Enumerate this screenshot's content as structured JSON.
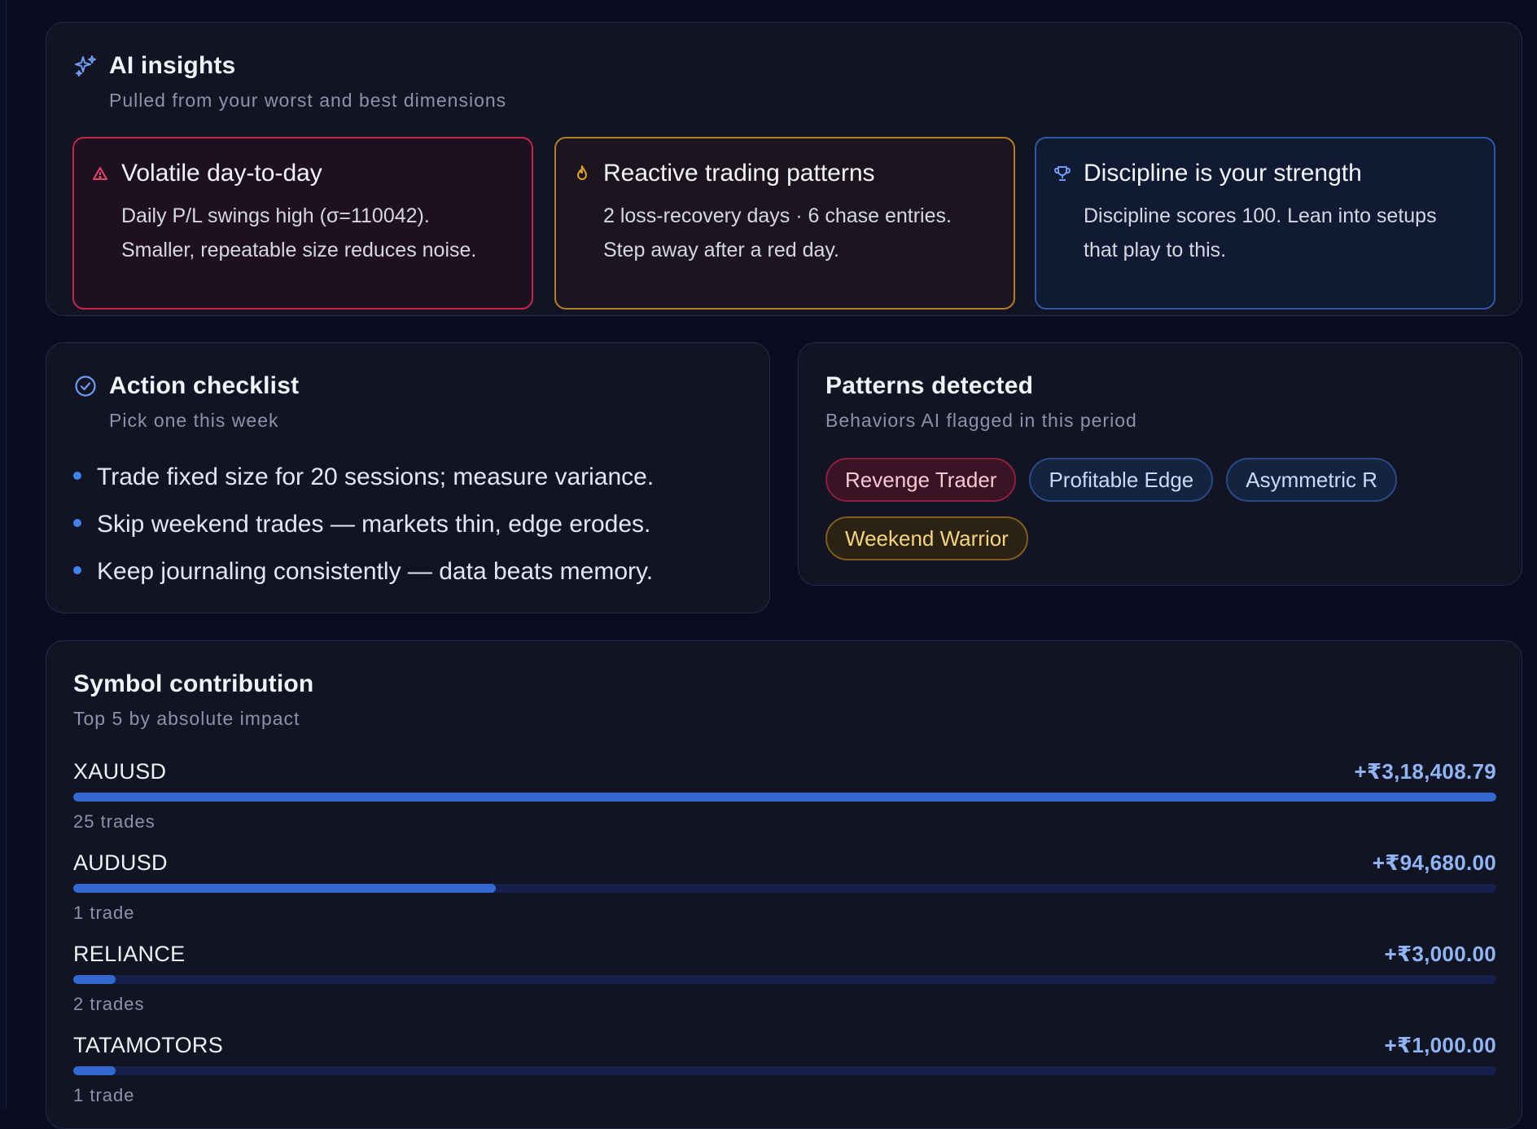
{
  "ai_insights": {
    "title": "AI insights",
    "subtitle": "Pulled from your worst and best dimensions",
    "cards": [
      {
        "icon": "warning-icon",
        "title": "Volatile day-to-day",
        "line1": "Daily P/L swings high (σ=110042).",
        "line2": "Smaller, repeatable size reduces noise.",
        "accent": "#c6264e"
      },
      {
        "icon": "flame-icon",
        "title": "Reactive trading patterns",
        "line1": "2 loss-recovery days · 6 chase entries.",
        "line2": "Step away after a red day.",
        "accent": "#b07f26"
      },
      {
        "icon": "trophy-icon",
        "title": "Discipline is your strength",
        "line1": "Discipline scores 100. Lean into setups",
        "line2": "that play to this.",
        "accent": "#2c5aa8"
      }
    ]
  },
  "action_checklist": {
    "title": "Action checklist",
    "subtitle": "Pick one this week",
    "items": [
      "Trade fixed size for 20 sessions; measure variance.",
      "Skip weekend trades — markets thin, edge erodes.",
      "Keep journaling consistently — data beats memory."
    ]
  },
  "patterns": {
    "title": "Patterns detected",
    "subtitle": "Behaviors AI flagged in this period",
    "pills": [
      "Revenge Trader",
      "Profitable Edge",
      "Asymmetric R",
      "Weekend Warrior"
    ]
  },
  "symbol_contribution": {
    "title": "Symbol contribution",
    "subtitle": "Top 5 by absolute impact",
    "rows": [
      {
        "symbol": "XAUUSD",
        "value": "+₹3,18,408.79",
        "trades": "25 trades",
        "share": 1.0
      },
      {
        "symbol": "AUDUSD",
        "value": "+₹94,680.00",
        "trades": "1 trade",
        "share": 0.297
      },
      {
        "symbol": "RELIANCE",
        "value": "+₹3,000.00",
        "trades": "2 trades",
        "share": 0.03
      },
      {
        "symbol": "TATAMOTORS",
        "value": "+₹1,000.00",
        "trades": "1 trade",
        "share": 0.03
      }
    ]
  },
  "colors": {
    "background": "#0a0d1f",
    "card": "#121424",
    "accent_blue": "#3468d1"
  }
}
